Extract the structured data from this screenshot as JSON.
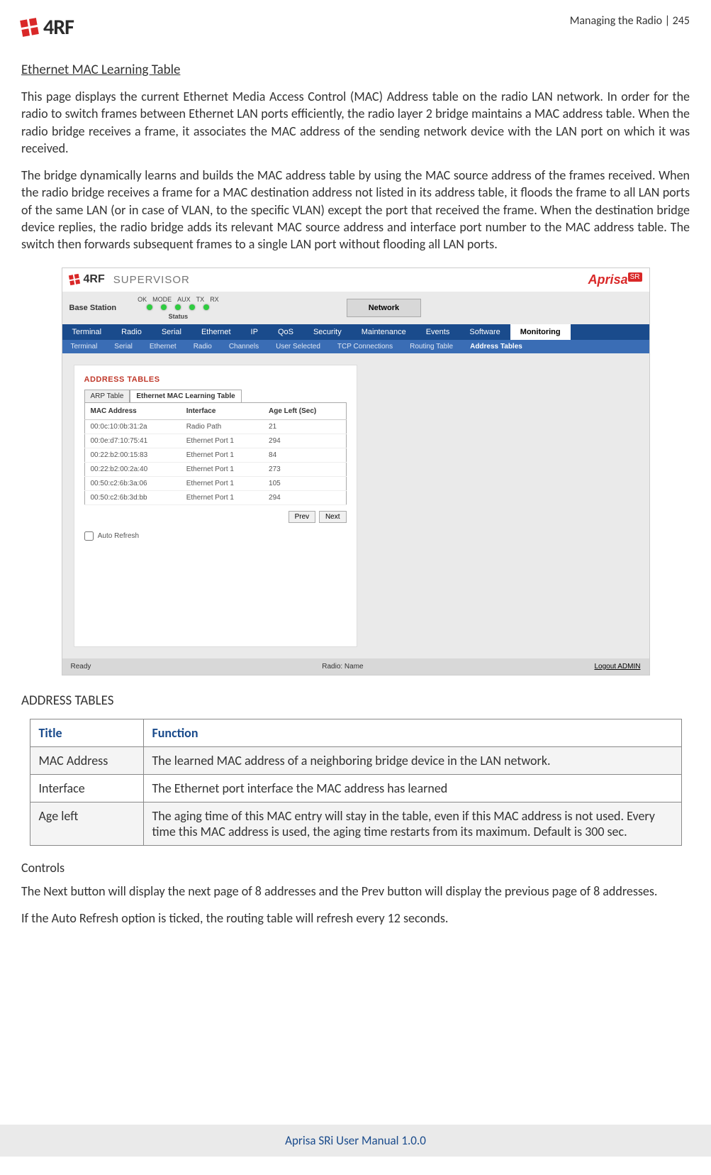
{
  "header": {
    "brand": "4RF",
    "page_ref": "Managing the Radio  |  245"
  },
  "section_heading": "Ethernet MAC Learning Table",
  "paragraphs": {
    "p1": "This page displays the current Ethernet Media Access Control (MAC) Address table on the radio LAN network. In order for the radio to switch frames between Ethernet LAN ports efficiently, the radio layer 2 bridge maintains a MAC address table. When the radio bridge receives a frame, it associates the MAC address of the sending network device with the LAN port on which it was received.",
    "p2": "The bridge dynamically learns and builds the MAC address table by using the MAC source address of the frames received. When the radio bridge receives a frame for a MAC destination address not listed in its address table, it floods the frame to all LAN ports of the same LAN (or in case of VLAN, to the specific VLAN) except the port that received the frame. When the destination bridge device replies, the radio bridge adds its relevant MAC source address and interface port number to the MAC address table. The switch then forwards subsequent frames to a single LAN port without flooding all LAN ports."
  },
  "screenshot": {
    "supervisor": "SUPERVISOR",
    "aprisa": "Aprisa",
    "aprisa_sr": "SR",
    "base_station": "Base Station",
    "led_labels": [
      "OK",
      "MODE",
      "AUX",
      "TX",
      "RX"
    ],
    "status_label": "Status",
    "network_btn": "Network",
    "nav1": [
      "Terminal",
      "Radio",
      "Serial",
      "Ethernet",
      "IP",
      "QoS",
      "Security",
      "Maintenance",
      "Events",
      "Software",
      "Monitoring"
    ],
    "nav1_active": "Monitoring",
    "nav2": [
      "Terminal",
      "Serial",
      "Ethernet",
      "Radio",
      "Channels",
      "User Selected",
      "TCP Connections",
      "Routing Table",
      "Address Tables"
    ],
    "nav2_active": "Address Tables",
    "panel_title": "ADDRESS TABLES",
    "tabs": [
      "ARP Table",
      "Ethernet MAC Learning Table"
    ],
    "tabs_active": "Ethernet MAC Learning Table",
    "table_headers": [
      "MAC Address",
      "Interface",
      "Age Left (Sec)"
    ],
    "table_rows": [
      {
        "mac": "00:0c:10:0b:31:2a",
        "iface": "Radio Path",
        "age": "21"
      },
      {
        "mac": "00:0e:d7:10:75:41",
        "iface": "Ethernet Port 1",
        "age": "294"
      },
      {
        "mac": "00:22:b2:00:15:83",
        "iface": "Ethernet Port 1",
        "age": "84"
      },
      {
        "mac": "00:22:b2:00:2a:40",
        "iface": "Ethernet Port 1",
        "age": "273"
      },
      {
        "mac": "00:50:c2:6b:3a:06",
        "iface": "Ethernet Port 1",
        "age": "105"
      },
      {
        "mac": "00:50:c2:6b:3d:bb",
        "iface": "Ethernet Port 1",
        "age": "294"
      }
    ],
    "prev": "Prev",
    "next": "Next",
    "auto_refresh": "Auto Refresh",
    "status_ready": "Ready",
    "status_radio": "Radio: Name",
    "status_logout": "Logout ADMIN"
  },
  "address_tables_heading": "ADDRESS TABLES",
  "def_table": {
    "h1": "Title",
    "h2": "Function",
    "rows": [
      {
        "title": "MAC Address",
        "func": "The learned MAC address of a neighboring bridge device in the LAN network."
      },
      {
        "title": "Interface",
        "func": "The Ethernet port interface the MAC address has learned"
      },
      {
        "title": "Age left",
        "func": "The aging time of this MAC entry will stay in the table, even if this MAC address is not used. Every time this MAC address is used, the aging time restarts from its maximum. Default is 300 sec."
      }
    ]
  },
  "controls_heading": "Controls",
  "controls_p1": "The Next button will display the next page of 8 addresses and the Prev button will display the previous page of 8 addresses.",
  "controls_p2": "If the Auto Refresh option is ticked, the routing table will refresh every 12 seconds.",
  "footer": "Aprisa SRi User Manual 1.0.0"
}
